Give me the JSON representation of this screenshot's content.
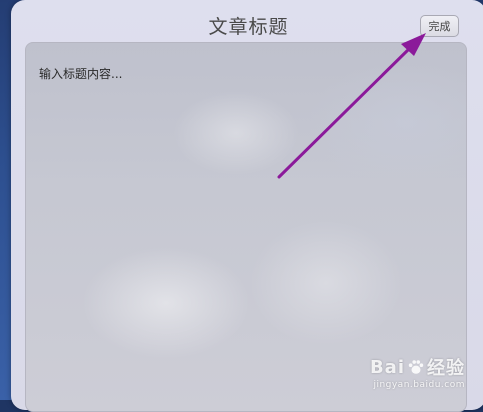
{
  "header": {
    "title": "文章标题",
    "done_label": "完成"
  },
  "editor": {
    "placeholder": "输入标题内容..."
  },
  "watermark": {
    "brand_left": "Bai",
    "brand_right": "经验",
    "site": "jingyan.baidu.com"
  },
  "colors": {
    "arrow": "#8b1a9a",
    "backdrop": "#2d4f8f",
    "sheet": "#dcdcec"
  }
}
